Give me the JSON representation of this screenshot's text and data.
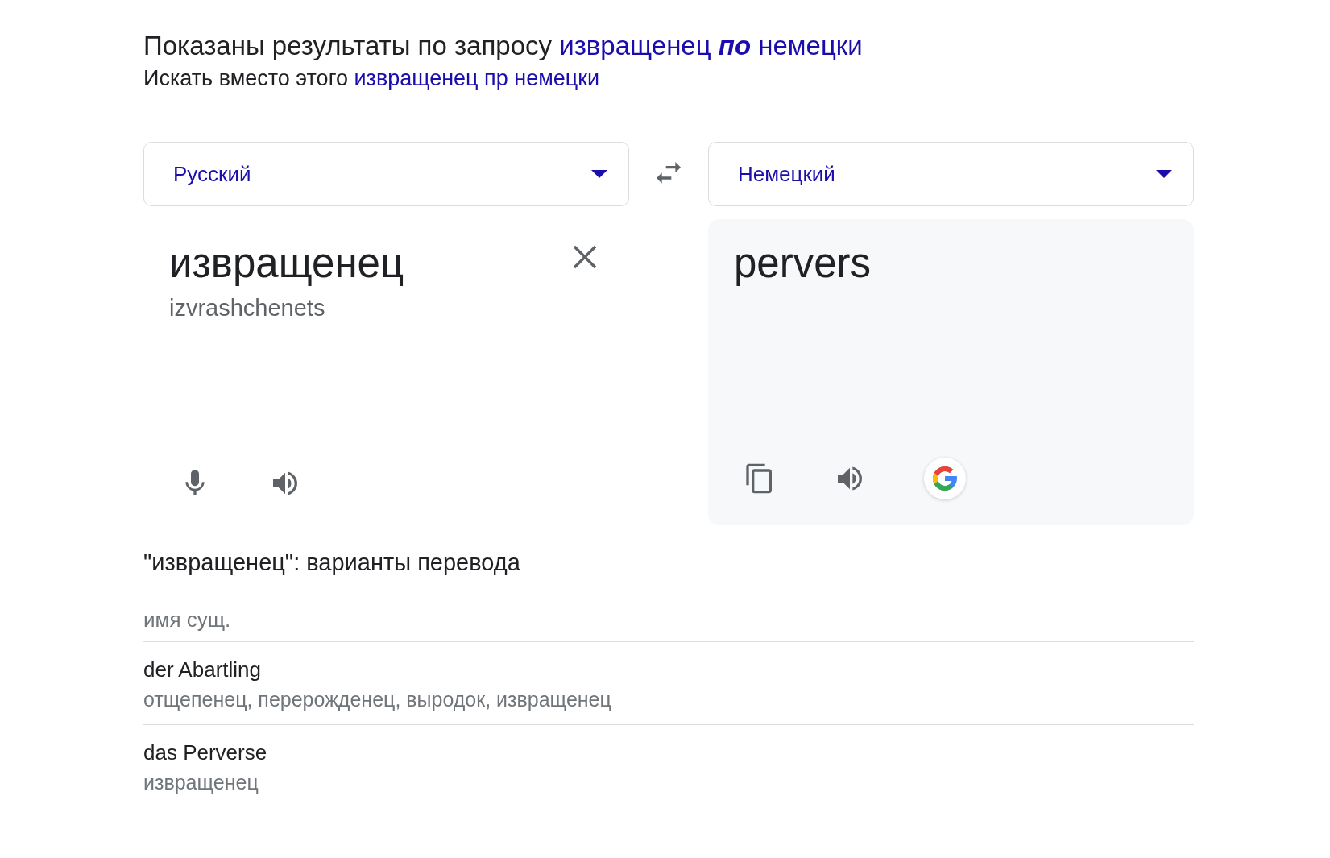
{
  "spelling": {
    "showing_prefix": "Показаны результаты по запросу",
    "showing_query": "извращенец **по** немецки",
    "instead_prefix": "Искать вместо этого",
    "instead_query": "извращенец пр немецки"
  },
  "source_language": {
    "label": "Русский"
  },
  "target_language": {
    "label": "Немецкий"
  },
  "source": {
    "text": "извращенец",
    "transliteration": "izvrashchenets"
  },
  "target": {
    "text": "pervers"
  },
  "dictionary": {
    "heading": "\"извращенец\": варианты перевода",
    "sections": [
      {
        "part_of_speech": "имя сущ.",
        "entries": [
          {
            "term": "der Abartling",
            "synonyms": "отщепенец, перерожденец, выродок, извращенец"
          },
          {
            "term": "das Perverse",
            "synonyms": "извращенец"
          }
        ]
      }
    ]
  }
}
